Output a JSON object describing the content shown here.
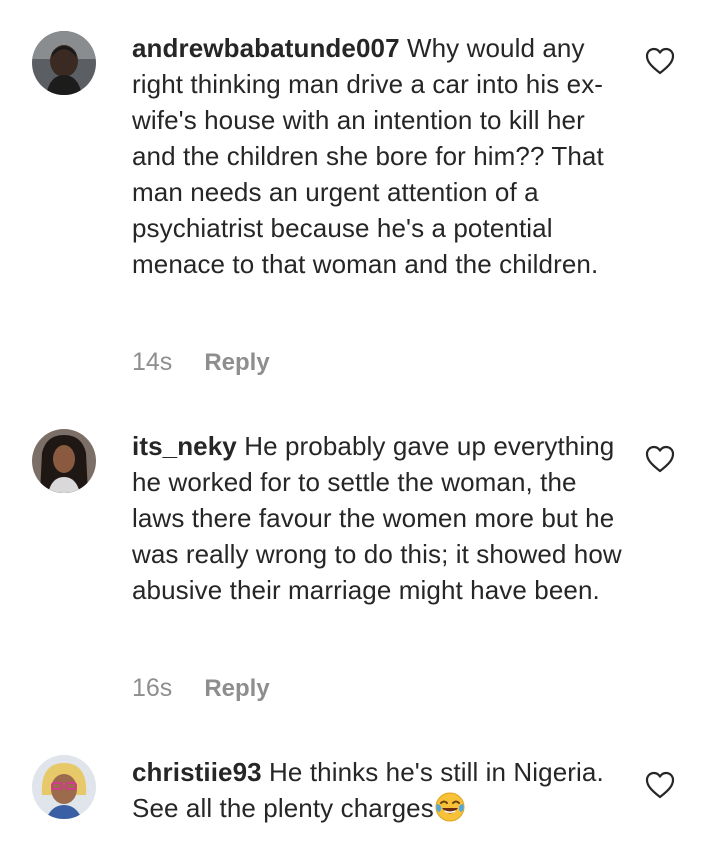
{
  "comments": [
    {
      "username": "andrewbabatunde007",
      "text": " Why would any right thinking man drive a car into his ex-wife's house with an intention to kill her and the children she bore for him?? That man needs an urgent attention of a psychiatrist because he's a potential menace to that woman and the children.",
      "time": "14s",
      "reply": "Reply",
      "avatar": "avatar-man-dark"
    },
    {
      "username": "its_neky",
      "text": " He probably gave up everything he worked for to settle the woman, the laws there favour the women more but he was really wrong to do this; it showed how abusive their marriage might have been.",
      "time": "16s",
      "reply": "Reply",
      "avatar": "avatar-woman-dark-hair"
    },
    {
      "username": "christiie93",
      "text": " He thinks he's still in Nigeria. See all the plenty charges",
      "emoji": "face-with-tears-of-joy",
      "avatar": "avatar-woman-glasses"
    }
  ],
  "icons": {
    "like": "heart-outline-icon"
  },
  "colors": {
    "text": "#262626",
    "meta": "#8e8e8e",
    "background": "#ffffff"
  }
}
